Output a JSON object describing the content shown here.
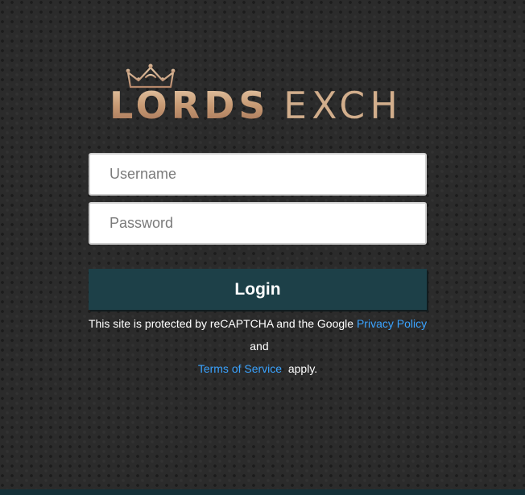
{
  "logo": {
    "word1": "LORDS",
    "word2": "EXCH",
    "icon": "crown-icon",
    "colors": {
      "gold": "#c9a27e",
      "gold_light": "#e3c4a2"
    }
  },
  "form": {
    "username_placeholder": "Username",
    "password_placeholder": "Password",
    "login_label": "Login"
  },
  "recaptcha": {
    "text_before": "This site is protected by reCAPTCHA and the Google",
    "privacy_link": "Privacy Policy",
    "text_middle": "and",
    "terms_link": "Terms of Service",
    "text_after": "apply."
  },
  "colors": {
    "background": "#2b2b2b",
    "button": "#1d4048",
    "link": "#3aa3ff"
  }
}
